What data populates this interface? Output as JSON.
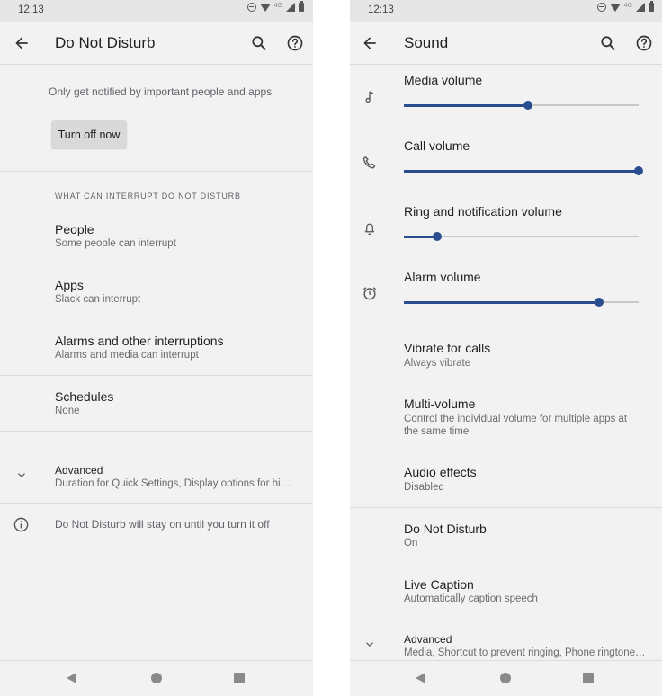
{
  "status": {
    "time": "12:13",
    "network": "4G"
  },
  "dnd": {
    "title": "Do Not Disturb",
    "description": "Only get notified by important people and apps",
    "turn_off_label": "Turn off now",
    "section_header": "WHAT CAN INTERRUPT DO NOT DISTURB",
    "items": [
      {
        "title": "People",
        "subtitle": "Some people can interrupt"
      },
      {
        "title": "Apps",
        "subtitle": "Slack can interrupt"
      },
      {
        "title": "Alarms and other interruptions",
        "subtitle": "Alarms and media can interrupt"
      }
    ],
    "schedules": {
      "title": "Schedules",
      "subtitle": "None"
    },
    "advanced": {
      "title": "Advanced",
      "subtitle": "Duration for Quick Settings, Display options for hi…"
    },
    "info": "Do Not Disturb will stay on until you turn it off"
  },
  "sound": {
    "title": "Sound",
    "volumes": [
      {
        "label": "Media volume",
        "icon": "music-note-icon",
        "level": 0.53
      },
      {
        "label": "Call volume",
        "icon": "phone-icon",
        "level": 1.0
      },
      {
        "label": "Ring and notification volume",
        "icon": "bell-icon",
        "level": 0.14
      },
      {
        "label": "Alarm volume",
        "icon": "alarm-clock-icon",
        "level": 0.83
      }
    ],
    "items": [
      {
        "title": "Vibrate for calls",
        "subtitle": "Always vibrate"
      },
      {
        "title": "Multi-volume",
        "subtitle_line1": "Control the individual volume for multiple apps at",
        "subtitle_line2": "the same time"
      },
      {
        "title": "Audio effects",
        "subtitle": "Disabled"
      },
      {
        "title": "Do Not Disturb",
        "subtitle": "On"
      },
      {
        "title": "Live Caption",
        "subtitle": "Automatically caption speech"
      }
    ],
    "advanced": {
      "title": "Advanced",
      "subtitle": "Media, Shortcut to prevent ringing, Phone ringtone…"
    }
  },
  "colors": {
    "accent": "#2a4d8f",
    "background": "#f2f2f2",
    "divider": "#dcdcdc"
  }
}
